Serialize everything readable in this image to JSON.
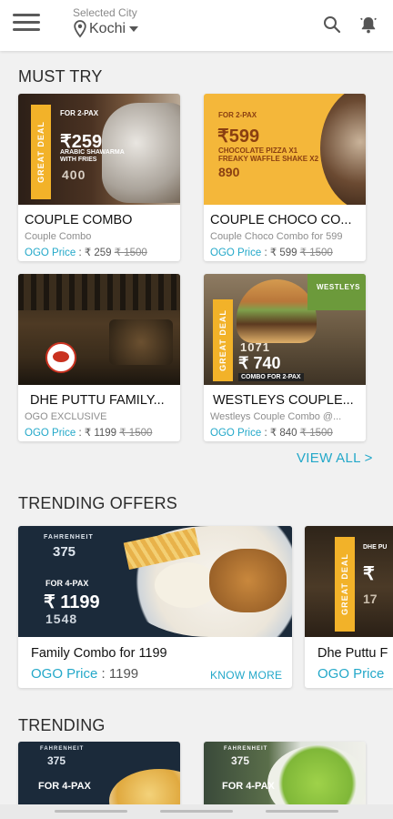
{
  "header": {
    "city_caption": "Selected City",
    "city_name": "Kochi"
  },
  "sections": {
    "must_try": "MUST TRY",
    "trending_offers": "TRENDING OFFERS",
    "trending": "TRENDING"
  },
  "must_try": [
    {
      "title": "COUPLE COMBO",
      "subtitle": "Couple Combo",
      "ogo_label": "OGO Price",
      "price": ": ₹ 259",
      "old_price": "₹ 1500",
      "promo": {
        "tag": "GREAT DEAL",
        "pax": "FOR 2-PAX",
        "price": "₹259",
        "desc": "ARABIC SHAWARMA WITH FRIES",
        "old": "400"
      }
    },
    {
      "title": "COUPLE CHOCO CO...",
      "subtitle": "Couple Choco Combo for 599",
      "ogo_label": "OGO Price",
      "price": ": ₹ 599",
      "old_price": "₹ 1500",
      "promo": {
        "pax": "FOR 2-PAX",
        "price": "₹599",
        "desc1": "CHOCOLATE PIZZA X1",
        "desc2": "FREAKY WAFFLE SHAKE X2",
        "old": "890"
      }
    },
    {
      "title": "DHE PUTTU FAMILY...",
      "subtitle": "OGO EXCLUSIVE",
      "ogo_label": "OGO Price",
      "price": ": ₹ 1199",
      "old_price": "₹ 1500",
      "promo": {}
    },
    {
      "title": "WESTLEYS COUPLE...",
      "subtitle": "Westleys Couple Combo @...",
      "ogo_label": "OGO Price",
      "price": ": ₹ 840",
      "old_price": "₹ 1500",
      "promo": {
        "tag": "GREAT DEAL",
        "old": "1071",
        "price": "₹ 740",
        "pax": "COMBO FOR 2-PAX",
        "logo": "WESTLEYS"
      }
    }
  ],
  "view_all": "VIEW ALL >",
  "trending_offers": [
    {
      "title": "Family Combo for 1199",
      "ogo_label": "OGO Price",
      "price": ": 1199",
      "action": "KNOW MORE",
      "promo": {
        "brand_top": "FAHRENHEIT",
        "brand_num": "375",
        "pax": "FOR 4-PAX",
        "price": "₹ 1199",
        "old": "1548"
      }
    },
    {
      "title": "Dhe Puttu F",
      "ogo_label": "OGO Price",
      "promo": {
        "tag": "GREAT DEAL",
        "pax": "DHE PU",
        "price": "₹",
        "old": "17"
      }
    }
  ],
  "trending": [
    {
      "promo": {
        "brand_top": "FAHRENHEIT",
        "brand_num": "375",
        "pax": "FOR 4-PAX"
      }
    },
    {
      "promo": {
        "brand_top": "FAHRENHEIT",
        "brand_num": "375",
        "pax": "FOR 4-PAX"
      }
    }
  ]
}
